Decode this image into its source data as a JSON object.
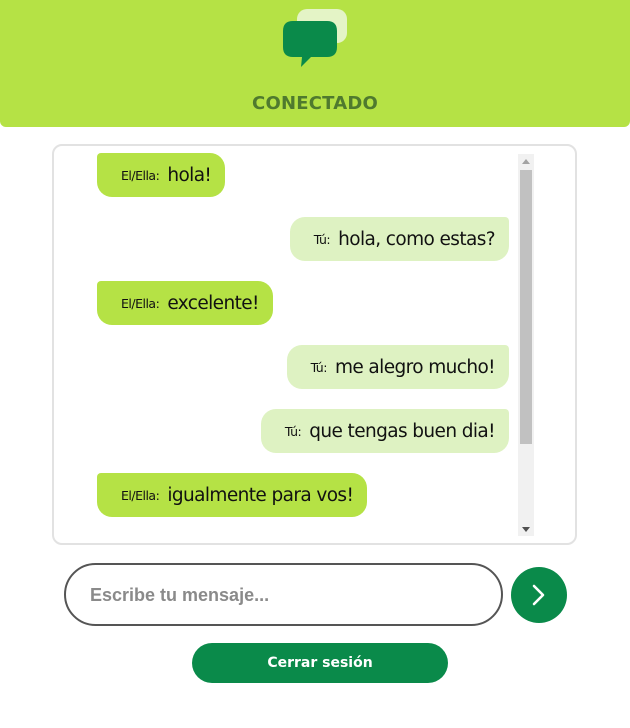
{
  "header": {
    "logo_icon": "chat-bubbles-icon",
    "status": "CONECTADO",
    "background_color": "#b5e245"
  },
  "chat": {
    "messages": [
      {
        "from": "them",
        "sender": "El/Ella:",
        "text": "hola!"
      },
      {
        "from": "me",
        "sender": "Tú:",
        "text": "hola, como estas?"
      },
      {
        "from": "them",
        "sender": "El/Ella:",
        "text": "excelente!"
      },
      {
        "from": "me",
        "sender": "Tú:",
        "text": "me alegro mucho!"
      },
      {
        "from": "me",
        "sender": "Tú:",
        "text": "que tengas buen dia!"
      },
      {
        "from": "them",
        "sender": "El/Ella:",
        "text": "igualmente para vos!"
      }
    ]
  },
  "composer": {
    "placeholder": "Escribe tu mensaje...",
    "value": "",
    "send_icon": "chevron-right-icon"
  },
  "logout": {
    "label": "Cerrar sesión"
  },
  "colors": {
    "accent": "#0a8a4a",
    "their_bubble": "#b5e245",
    "my_bubble": "#def2c2"
  }
}
